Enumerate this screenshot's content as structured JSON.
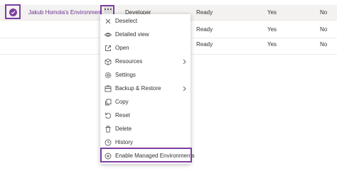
{
  "rows": [
    {
      "name": "Jakub Homola's Environment",
      "type": "Developer",
      "state": "Ready",
      "col4": "Yes",
      "col5": "No"
    },
    {
      "name": "",
      "type": "",
      "state": "Ready",
      "col4": "Yes",
      "col5": "No"
    },
    {
      "name": "",
      "type": "",
      "state": "Ready",
      "col4": "Yes",
      "col5": "No"
    }
  ],
  "menu": {
    "items": [
      {
        "label": "Deselect",
        "icon": "close-icon"
      },
      {
        "label": "Detailed view",
        "icon": "eye-icon"
      },
      {
        "label": "Open",
        "icon": "open-in-new-icon"
      },
      {
        "label": "Resources",
        "icon": "cube-icon",
        "submenu": true
      },
      {
        "label": "Settings",
        "icon": "gear-icon"
      },
      {
        "label": "Backup & Restore",
        "icon": "backup-icon",
        "submenu": true
      },
      {
        "label": "Copy",
        "icon": "copy-icon"
      },
      {
        "label": "Reset",
        "icon": "reset-icon"
      },
      {
        "label": "Delete",
        "icon": "trash-icon"
      },
      {
        "label": "History",
        "icon": "history-icon"
      },
      {
        "label": "Enable Managed Environments",
        "icon": "add-circle-icon"
      }
    ]
  },
  "colors": {
    "accent": "#7b3fa0",
    "selected_row": "#f3f2f1",
    "link": "#6b2f8e"
  }
}
